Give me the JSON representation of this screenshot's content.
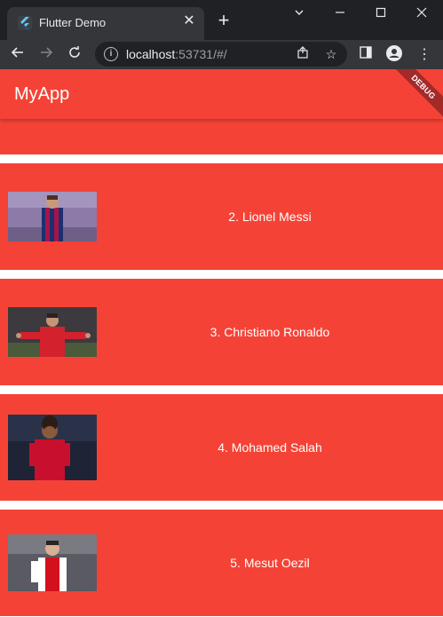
{
  "browser": {
    "tab_title": "Flutter Demo",
    "url_host": "localhost",
    "url_rest": ":53731/#/"
  },
  "app": {
    "title": "MyApp",
    "debug_banner": "DEBUG"
  },
  "players": [
    {
      "label": "",
      "thumb": "player-photo"
    },
    {
      "label": "2. Lionel Messi",
      "thumb": "player-photo"
    },
    {
      "label": "3. Christiano Ronaldo",
      "thumb": "player-photo"
    },
    {
      "label": "4. Mohamed Salah",
      "thumb": "player-photo"
    },
    {
      "label": "5. Mesut Oezil",
      "thumb": "player-photo"
    }
  ],
  "colors": {
    "primary": "#f44336",
    "chrome_dark": "#202124",
    "chrome_toolbar": "#35363a"
  }
}
